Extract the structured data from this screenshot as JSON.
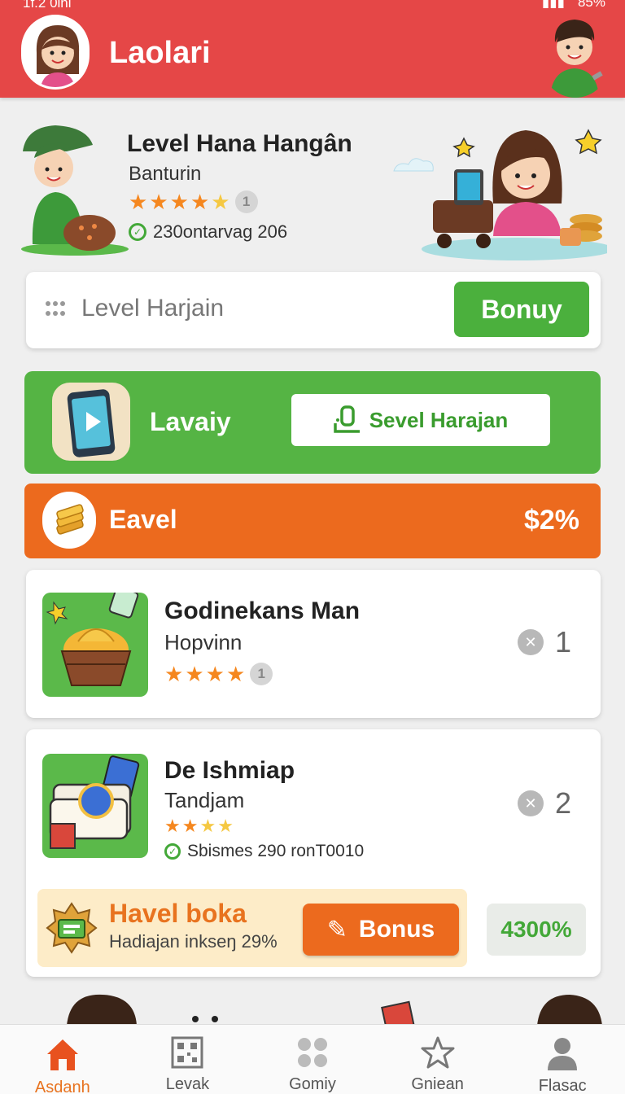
{
  "status_bar": {
    "time": "1f.2 0ini",
    "battery": "85%"
  },
  "header": {
    "title": "Laolari"
  },
  "profile": {
    "title": "Level Hana Hangân",
    "subtitle": "Banturin",
    "rating": 4.5,
    "rating_count": "1",
    "meta": "230ontarvag 206"
  },
  "search": {
    "placeholder": "Level Harjain",
    "button_label": "Bonuy"
  },
  "green_banner": {
    "label": "Lavaiy",
    "button_label": "Sevel Harajan"
  },
  "orange_banner": {
    "label": "Eavel",
    "value": "$2%"
  },
  "items": [
    {
      "title": "Godinekans Man",
      "subtitle": "Hopvinn",
      "rating": 4,
      "rating_count": "1",
      "rank": "1"
    },
    {
      "title": "De Ishmiap",
      "subtitle": "Tandjam",
      "rating": 2.5,
      "meta": "Sbismes 290 ronT0010",
      "rank": "2"
    }
  ],
  "promo": {
    "title": "Havel boka",
    "subtitle": "Hadiajan inkseŋ 29%",
    "button_label": "Bonus",
    "pct": "4300%"
  },
  "nav": [
    {
      "label": "Asdanh",
      "icon": "home-icon",
      "active": true
    },
    {
      "label": "Levak",
      "icon": "qr-icon",
      "active": false
    },
    {
      "label": "Gomiy",
      "icon": "grid-icon",
      "active": false
    },
    {
      "label": "Gniean",
      "icon": "star-icon",
      "active": false
    },
    {
      "label": "Flasac",
      "icon": "user-icon",
      "active": false
    }
  ],
  "colors": {
    "header": "#e54747",
    "green": "#55b444",
    "orange": "#ec6a1e",
    "star": "#f5871f"
  }
}
